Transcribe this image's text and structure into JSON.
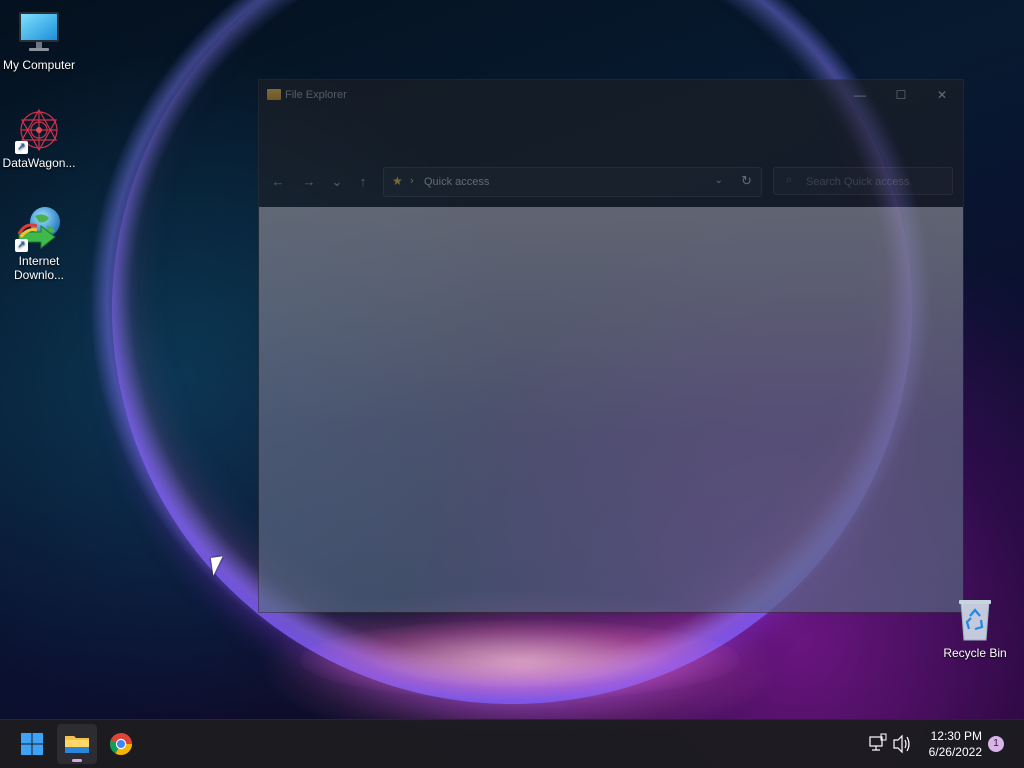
{
  "desktop": {
    "icons": [
      {
        "label": "My Computer",
        "icon": "monitor-icon"
      },
      {
        "label": "DataWagon...",
        "icon": "datawagon-icon",
        "shortcut": true
      },
      {
        "label": "Internet Downlo...",
        "label_line1": "Internet",
        "label_line2": "Downlo...",
        "icon": "internet-download-manager-icon",
        "shortcut": true
      }
    ],
    "recycle_bin": {
      "label": "Recycle Bin",
      "icon": "recycle-bin-icon"
    }
  },
  "explorer": {
    "title": "File Explorer",
    "window_controls": {
      "minimize": "—",
      "maximize": "☐",
      "close": "✕"
    },
    "nav": {
      "back": "←",
      "forward": "→",
      "recent": "⌄",
      "up": "↑"
    },
    "address": {
      "separator": "›",
      "location": "Quick access",
      "dropdown": "⌄",
      "refresh": "↻"
    },
    "search": {
      "placeholder": "Search Quick access"
    }
  },
  "taskbar": {
    "apps": [
      {
        "name": "Start",
        "icon": "windows-start-icon"
      },
      {
        "name": "File Explorer",
        "icon": "file-explorer-icon",
        "active": true
      },
      {
        "name": "Google Chrome",
        "icon": "chrome-icon"
      }
    ],
    "tray": {
      "time": "12:30 PM",
      "date": "6/26/2022",
      "notifications": "1"
    }
  },
  "colors": {
    "accent": "#d5a7e8",
    "taskbar": "#1c1c20",
    "start_blue": "#3fa3f5"
  }
}
